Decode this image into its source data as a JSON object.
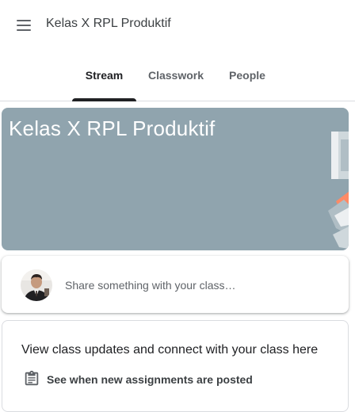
{
  "app": {
    "title": "Kelas X RPL Produktif",
    "menu_icon": "hamburger-menu-icon"
  },
  "tabs": [
    {
      "label": "Stream",
      "active": true
    },
    {
      "label": "Classwork",
      "active": false
    },
    {
      "label": "People",
      "active": false
    }
  ],
  "banner": {
    "title": "Kelas X RPL Produktif",
    "color": "#90a4ae"
  },
  "share": {
    "placeholder": "Share something with your class…",
    "avatar_icon": "user-avatar"
  },
  "info": {
    "heading": "View class updates and connect with your class here",
    "items": [
      {
        "icon": "assignment-icon",
        "text": "See when new assignments are posted"
      }
    ]
  },
  "colors": {
    "tab_indicator": "#202124",
    "text_primary": "#202124",
    "text_secondary": "#5f6368"
  }
}
